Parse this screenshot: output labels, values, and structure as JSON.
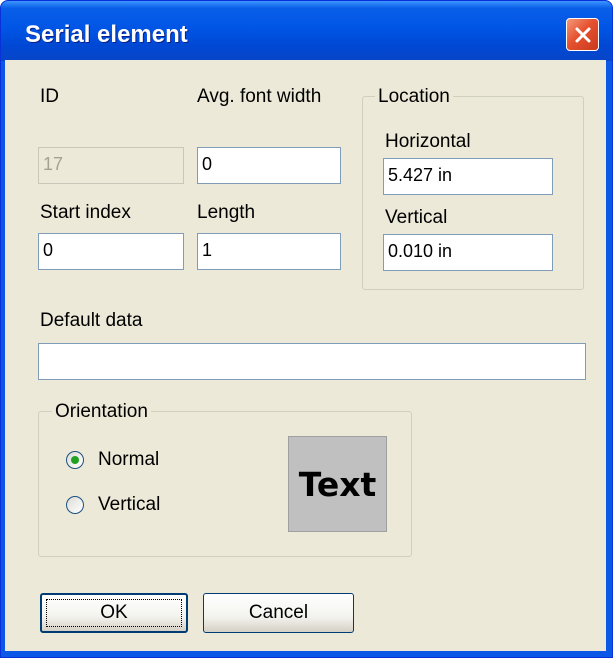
{
  "window": {
    "title": "Serial element"
  },
  "labels": {
    "id": "ID",
    "avg_font_width": "Avg. font width",
    "start_index": "Start index",
    "length": "Length",
    "default_data": "Default data"
  },
  "fields": {
    "id_value": "17",
    "avg_font_width_value": "0",
    "start_index_value": "0",
    "length_value": "1",
    "default_data_value": ""
  },
  "location": {
    "legend": "Location",
    "horizontal_label": "Horizontal",
    "horizontal_value": "5.427 in",
    "vertical_label": "Vertical",
    "vertical_value": "0.010 in"
  },
  "orientation": {
    "legend": "Orientation",
    "options": [
      "Normal",
      "Vertical"
    ],
    "selected": "Normal",
    "preview_text": "Text"
  },
  "buttons": {
    "ok": "OK",
    "cancel": "Cancel"
  },
  "colors": {
    "titlebar": "#0055e5",
    "client": "#ece9d8",
    "close": "#e5512f",
    "radio_dot": "#21a121"
  },
  "icons": {
    "close": "close-icon"
  }
}
